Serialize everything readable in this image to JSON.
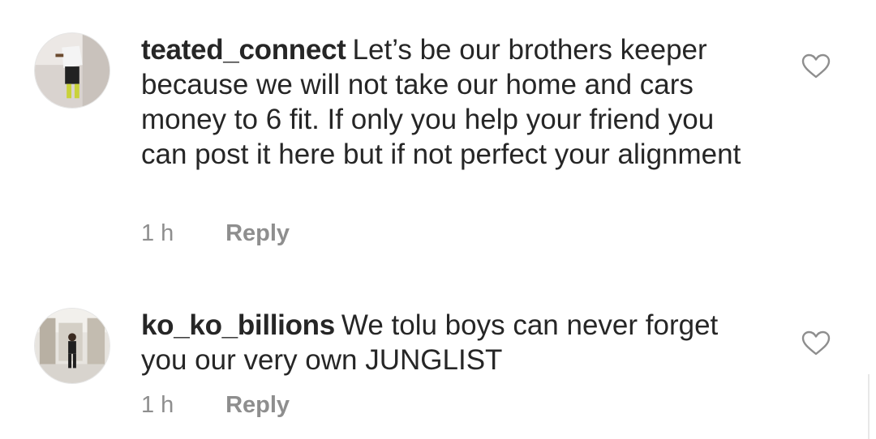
{
  "comments": [
    {
      "username": "teated_connect",
      "text": "Let’s be our brothers keeper because we will not take our home and cars money to 6 fit. If only you help your friend you can post it here but if not perfect your alignment",
      "time": "1 h",
      "reply_label": "Reply",
      "avatar_icon": "user-avatar-photo",
      "like_icon": "heart-outline-icon"
    },
    {
      "username": "ko_ko_billions",
      "text": "We tolu boys can never forget you our very own JUNGLIST",
      "time": "1 h",
      "reply_label": "Reply",
      "avatar_icon": "user-avatar-photo",
      "like_icon": "heart-outline-icon"
    }
  ],
  "colors": {
    "text": "#262626",
    "meta": "#8e8e8e",
    "background": "#ffffff"
  }
}
